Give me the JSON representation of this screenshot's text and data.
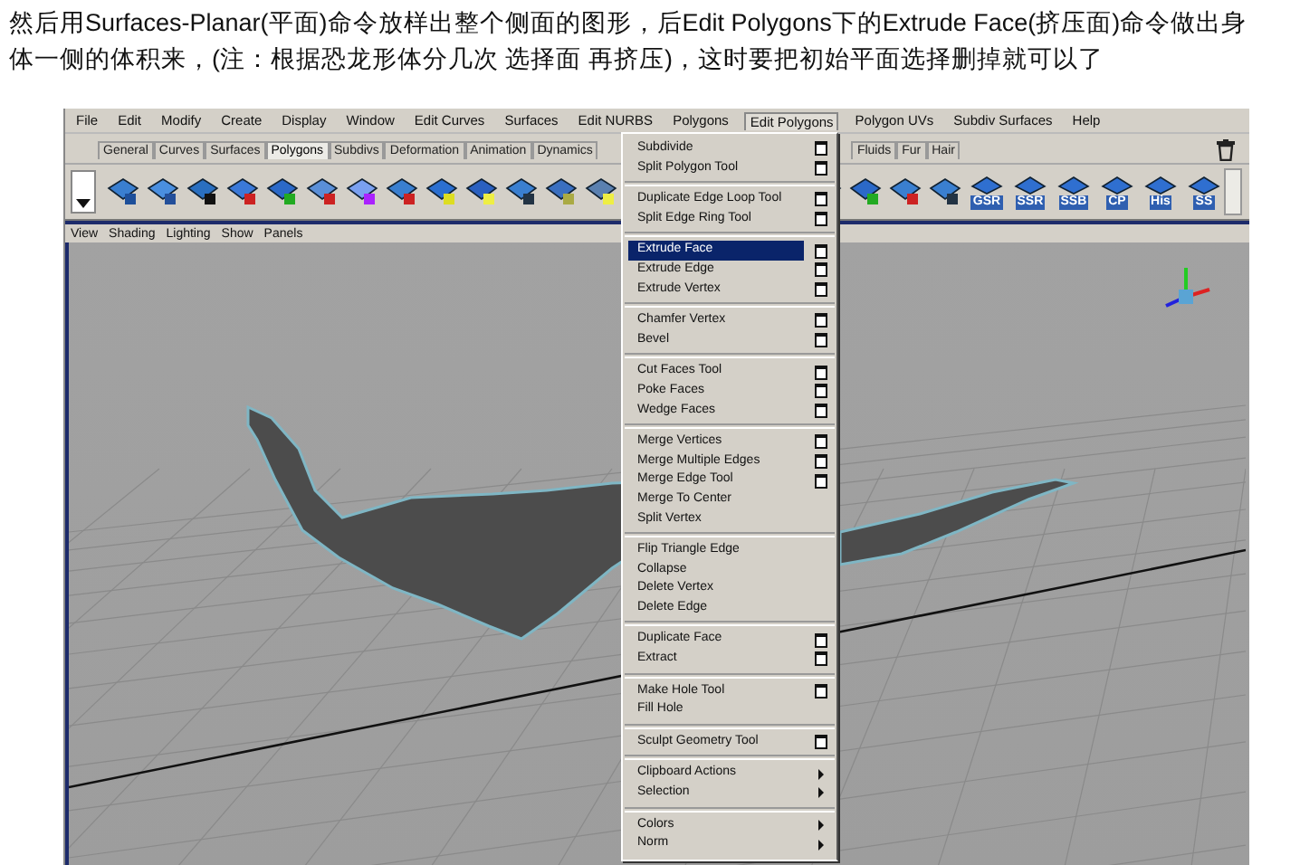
{
  "caption": "然后用Surfaces-Planar(平面)命令放样出整个侧面的图形，后Edit Polygons下的Extrude Face(挤压面)命令做出身体一侧的体积来，(注：根据恐龙形体分几次 选择面 再挤压)，这时要把初始平面选择删掉就可以了",
  "menubar": [
    {
      "label": "File",
      "selected": false
    },
    {
      "label": "Edit",
      "selected": false
    },
    {
      "label": "Modify",
      "selected": false
    },
    {
      "label": "Create",
      "selected": false
    },
    {
      "label": "Display",
      "selected": false
    },
    {
      "label": "Window",
      "selected": false
    },
    {
      "label": "Edit Curves",
      "selected": false
    },
    {
      "label": "Surfaces",
      "selected": false
    },
    {
      "label": "Edit NURBS",
      "selected": false
    },
    {
      "label": "Polygons",
      "selected": false
    },
    {
      "label": "Edit Polygons",
      "selected": true
    },
    {
      "label": "Polygon UVs",
      "selected": false
    },
    {
      "label": "Subdiv Surfaces",
      "selected": false
    },
    {
      "label": "Help",
      "selected": false
    }
  ],
  "shelf_tabs": [
    {
      "label": "General",
      "selected": false
    },
    {
      "label": "Curves",
      "selected": false
    },
    {
      "label": "Surfaces",
      "selected": false
    },
    {
      "label": "Polygons",
      "selected": true
    },
    {
      "label": "Subdivs",
      "selected": false
    },
    {
      "label": "Deformation",
      "selected": false
    },
    {
      "label": "Animation",
      "selected": false
    },
    {
      "label": "Dynamics",
      "selected": false
    }
  ],
  "shelf_tabs_right": [
    {
      "label": "Fluids",
      "selected": false
    },
    {
      "label": "Fur",
      "selected": false
    },
    {
      "label": "Hair",
      "selected": false
    }
  ],
  "shelf_labeled_buttons": [
    {
      "label": "GSR"
    },
    {
      "label": "SSR"
    },
    {
      "label": "SSB"
    },
    {
      "label": "CP"
    },
    {
      "label": "His"
    },
    {
      "label": "SS"
    }
  ],
  "viewport_menu": [
    "View",
    "Shading",
    "Lighting",
    "Show",
    "Panels"
  ],
  "dropdown": {
    "groups": [
      {
        "items": [
          {
            "label": "Subdivide",
            "kind": "option",
            "selected": false
          },
          {
            "label": "Split Polygon Tool",
            "kind": "option",
            "selected": false
          }
        ]
      },
      {
        "items": [
          {
            "label": "Duplicate Edge Loop Tool",
            "kind": "option",
            "selected": false
          },
          {
            "label": "Split Edge Ring Tool",
            "kind": "option",
            "selected": false
          }
        ]
      },
      {
        "items": [
          {
            "label": "Extrude Face",
            "kind": "option",
            "selected": true
          },
          {
            "label": "Extrude Edge",
            "kind": "option",
            "selected": false
          },
          {
            "label": "Extrude Vertex",
            "kind": "option",
            "selected": false
          }
        ]
      },
      {
        "items": [
          {
            "label": "Chamfer Vertex",
            "kind": "option",
            "selected": false
          },
          {
            "label": "Bevel",
            "kind": "option",
            "selected": false
          }
        ]
      },
      {
        "items": [
          {
            "label": "Cut Faces Tool",
            "kind": "option",
            "selected": false
          },
          {
            "label": "Poke Faces",
            "kind": "option",
            "selected": false
          },
          {
            "label": "Wedge Faces",
            "kind": "option",
            "selected": false
          }
        ]
      },
      {
        "items": [
          {
            "label": "Merge Vertices",
            "kind": "option",
            "selected": false
          },
          {
            "label": "Merge Multiple Edges",
            "kind": "option",
            "selected": false
          },
          {
            "label": "Merge Edge Tool",
            "kind": "option",
            "selected": false
          },
          {
            "label": "Merge To Center",
            "kind": "plain",
            "selected": false
          },
          {
            "label": "Split Vertex",
            "kind": "plain",
            "selected": false
          }
        ]
      },
      {
        "items": [
          {
            "label": "Flip Triangle Edge",
            "kind": "plain",
            "selected": false
          },
          {
            "label": "Collapse",
            "kind": "plain",
            "selected": false
          },
          {
            "label": "Delete Vertex",
            "kind": "plain",
            "selected": false
          },
          {
            "label": "Delete Edge",
            "kind": "plain",
            "selected": false
          }
        ]
      },
      {
        "items": [
          {
            "label": "Duplicate Face",
            "kind": "option",
            "selected": false
          },
          {
            "label": "Extract",
            "kind": "option",
            "selected": false
          }
        ]
      },
      {
        "items": [
          {
            "label": "Make Hole Tool",
            "kind": "option",
            "selected": false
          },
          {
            "label": "Fill Hole",
            "kind": "plain",
            "selected": false
          }
        ]
      },
      {
        "items": [
          {
            "label": "Sculpt Geometry Tool",
            "kind": "option",
            "selected": false
          }
        ]
      },
      {
        "items": [
          {
            "label": "Clipboard Actions",
            "kind": "submenu",
            "selected": false
          },
          {
            "label": "Selection",
            "kind": "submenu",
            "selected": false
          }
        ]
      },
      {
        "items": [
          {
            "label": "Colors",
            "kind": "submenu",
            "selected": false
          },
          {
            "label": "Norm",
            "kind": "submenu",
            "selected": false
          }
        ]
      }
    ]
  }
}
